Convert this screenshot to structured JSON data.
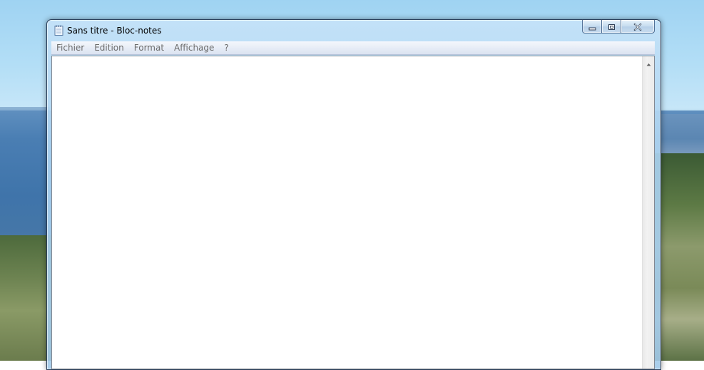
{
  "window": {
    "title": "Sans titre - Bloc-notes",
    "app_icon": "notepad-icon"
  },
  "caption_buttons": {
    "minimize_icon": "minimize-icon",
    "maximize_icon": "restore-icon",
    "close_icon": "close-icon"
  },
  "menu": {
    "items": [
      {
        "label": "Fichier"
      },
      {
        "label": "Edition"
      },
      {
        "label": "Format"
      },
      {
        "label": "Affichage"
      },
      {
        "label": "?"
      }
    ]
  },
  "editor": {
    "content": ""
  },
  "scrollbar": {
    "up_icon": "scroll-up-arrow-icon"
  },
  "colors": {
    "frame": "#2a3f5a",
    "menu_text": "#6b6b6b",
    "editor_bg": "#ffffff"
  }
}
